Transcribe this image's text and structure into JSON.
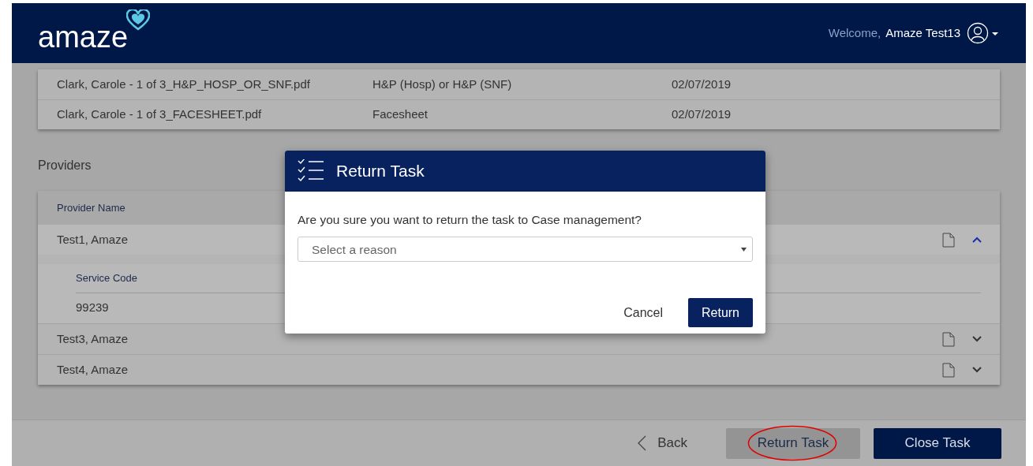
{
  "header": {
    "logo": "amaze",
    "welcome": "Welcome,",
    "user": "Amaze Test13"
  },
  "documents": [
    {
      "file": "Clark, Carole - 1 of 3_H&P_HOSP_OR_SNF.pdf",
      "type": "H&P (Hosp) or H&P (SNF)",
      "date": "02/07/2019"
    },
    {
      "file": "Clark, Carole - 1 of 3_FACESHEET.pdf",
      "type": "Facesheet",
      "date": "02/07/2019"
    }
  ],
  "providers": {
    "title": "Providers",
    "column": "Provider Name",
    "rows": [
      {
        "name": "Test1, Amaze",
        "expanded": true,
        "detail_column": "Service Code",
        "codes": [
          "99239"
        ]
      },
      {
        "name": "Test3, Amaze",
        "expanded": false
      },
      {
        "name": "Test4, Amaze",
        "expanded": false
      }
    ]
  },
  "dialog": {
    "title": "Return Task",
    "question": "Are you sure you want to return the task to Case management?",
    "select": {
      "placeholder": "Select a reason"
    },
    "buttons": [
      {
        "label": "Cancel",
        "kind": "text"
      },
      {
        "label": "Return",
        "kind": "primary"
      }
    ]
  },
  "footer": {
    "back": "Back",
    "buttons": [
      {
        "label": "Return Task",
        "kind": "secondary",
        "circled": true
      },
      {
        "label": "Close Task",
        "kind": "primary",
        "circled": false
      }
    ]
  }
}
